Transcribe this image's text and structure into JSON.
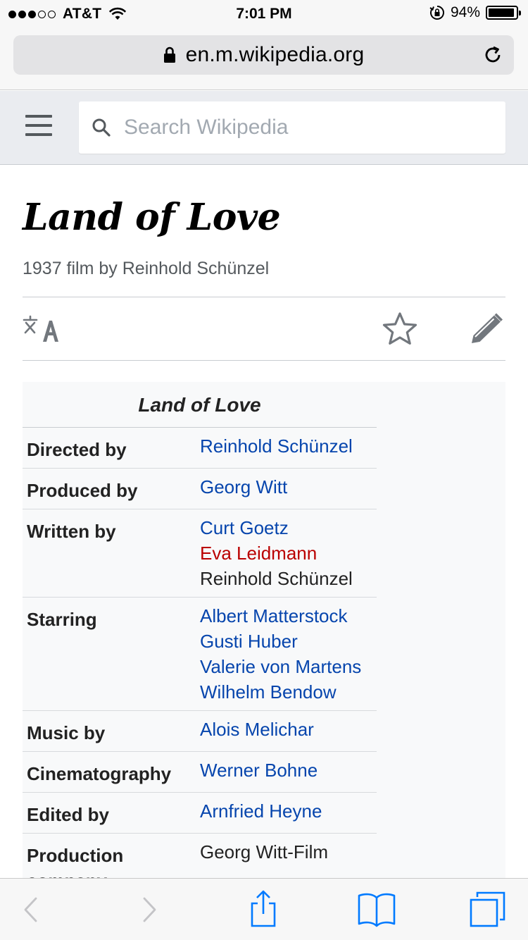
{
  "status_bar": {
    "carrier": "AT&T",
    "time": "7:01 PM",
    "battery_text": "94%",
    "battery_level": 0.94,
    "signal_bars_filled": 3,
    "signal_bars_total": 5
  },
  "url_bar": {
    "url": "en.m.wikipedia.org"
  },
  "wiki_header": {
    "search_placeholder": "Search Wikipedia"
  },
  "article": {
    "title": "Land of Love",
    "subtitle": "1937 film by Reinhold Schünzel"
  },
  "infobox": {
    "caption": "Land of Love",
    "rows": [
      {
        "label": "Directed by",
        "values": [
          {
            "text": "Reinhold Schünzel",
            "kind": "link"
          }
        ]
      },
      {
        "label": "Produced by",
        "values": [
          {
            "text": "Georg Witt",
            "kind": "link"
          }
        ]
      },
      {
        "label": "Written by",
        "values": [
          {
            "text": "Curt Goetz",
            "kind": "link"
          },
          {
            "text": "Eva Leidmann",
            "kind": "redlink"
          },
          {
            "text": "Reinhold Schünzel",
            "kind": "plain"
          }
        ]
      },
      {
        "label": "Starring",
        "values": [
          {
            "text": "Albert Matterstock",
            "kind": "link"
          },
          {
            "text": "Gusti Huber",
            "kind": "link"
          },
          {
            "text": "Valerie von Martens",
            "kind": "link"
          },
          {
            "text": "Wilhelm Bendow",
            "kind": "link"
          }
        ]
      },
      {
        "label": "Music by",
        "values": [
          {
            "text": "Alois Melichar",
            "kind": "link"
          }
        ]
      },
      {
        "label": "Cinematography",
        "values": [
          {
            "text": "Werner Bohne",
            "kind": "link"
          }
        ]
      },
      {
        "label": "Edited by",
        "values": [
          {
            "text": "Arnfried Heyne",
            "kind": "link"
          }
        ]
      },
      {
        "label": "Production company",
        "values": [
          {
            "text": "Georg Witt-Film",
            "kind": "plain"
          }
        ]
      }
    ]
  },
  "icons": {
    "menu": "hamburger-menu-icon",
    "search": "search-icon",
    "language": "language-icon",
    "watch": "star-icon",
    "edit": "pencil-icon",
    "lock": "lock-icon",
    "reload": "reload-icon",
    "back": "chevron-left-icon",
    "forward": "chevron-right-icon",
    "share": "share-icon",
    "bookmarks": "book-icon",
    "tabs": "tabs-icon"
  },
  "colors": {
    "link": "#0645ad",
    "redlink": "#ba0000",
    "ios_blue": "#007aff"
  }
}
